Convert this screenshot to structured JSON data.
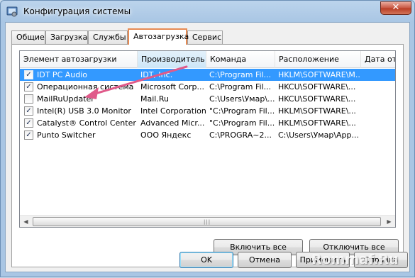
{
  "window": {
    "title": "Конфигурация системы",
    "close_glyph": "✕"
  },
  "tabs": [
    {
      "label": "Общие"
    },
    {
      "label": "Загрузка"
    },
    {
      "label": "Службы"
    },
    {
      "label": "Автозагрузка",
      "active": true
    },
    {
      "label": "Сервис"
    }
  ],
  "table": {
    "columns": [
      "Элемент автозагрузки",
      "Производитель",
      "Команда",
      "Расположение",
      "Дата от"
    ],
    "rows": [
      {
        "checked": true,
        "name": "IDT PC Audio",
        "vendor": "IDT, Inc.",
        "command": "C:\\Program Fil...",
        "location": "HKLM\\SOFTWARE\\M...",
        "selected": true
      },
      {
        "checked": true,
        "name": "Операционная система Mi...",
        "vendor": "Microsoft Corp...",
        "command": "C:\\Program Fil...",
        "location": "HKCU\\SOFTWARE\\..."
      },
      {
        "checked": false,
        "name": "MailRuUpdater",
        "vendor": "Mail.Ru",
        "command": "C:\\Users\\Умар\\...",
        "location": "HKCU\\SOFTWARE\\..."
      },
      {
        "checked": true,
        "name": "Intel(R) USB 3.0 Monitor",
        "vendor": "Intel Corporation",
        "command": "\"C:\\Program Fil...",
        "location": "HKLM\\SOFTWARE\\..."
      },
      {
        "checked": true,
        "name": "Catalyst® Control Center",
        "vendor": "Advanced Micr...",
        "command": "\"C:\\Program Fil...",
        "location": "HKLM\\SOFTWARE\\..."
      },
      {
        "checked": true,
        "name": "Punto Switcher",
        "vendor": "ООО Яндекс",
        "command": "C:\\PROGRA~2...",
        "location": "C:\\Users\\Умар\\App..."
      }
    ],
    "check_glyph": "✓"
  },
  "scrollbar": {
    "left_arrow": "◀",
    "right_arrow": "▶",
    "grip": "|||"
  },
  "actions": {
    "enable_all": "Включить все",
    "disable_all": "Отключить все"
  },
  "footer": {
    "ok": "OK",
    "cancel": "Отмена",
    "apply": "Применить",
    "help": "Справка"
  },
  "watermark": "Rommaf.Ru",
  "colors": {
    "selection": "#3399ff",
    "tab_highlight": "#e78a52",
    "annotation_arrow": "#e05a8a"
  }
}
